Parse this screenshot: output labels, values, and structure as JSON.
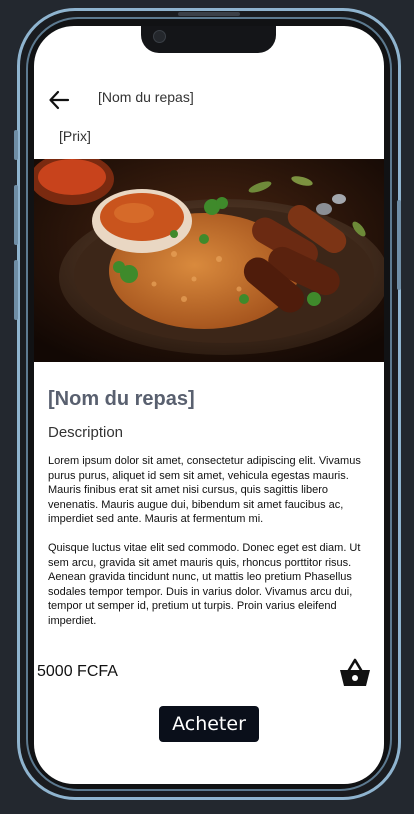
{
  "header": {
    "back_icon": "arrow-left-icon",
    "title": "[Nom du repas]"
  },
  "price_top": "[Prix]",
  "hero_image": {
    "subject": "jollof-rice-plate"
  },
  "meal": {
    "title": "[Nom du repas]",
    "description_label": "Description",
    "paragraphs": [
      "Lorem ipsum dolor sit amet, consectetur adipiscing elit. Vivamus purus purus, aliquet id sem sit amet, vehicula egestas mauris. Mauris finibus erat sit amet nisi cursus, quis sagittis libero venenatis. Mauris augue dui, bibendum sit amet faucibus ac, imperdiet sed ante. Mauris at fermentum mi.",
      "Quisque luctus vitae elit sed commodo. Donec eget est diam. Ut sem arcu, gravida sit amet mauris quis, rhoncus porttitor risus. Aenean gravida tincidunt nunc, ut mattis leo pretium Phasellus sodales tempor tempor. Duis in varius dolor. Vivamus arcu dui, tempor ut semper id, pretium ut turpis. Proin varius eleifend imperdiet."
    ]
  },
  "footer": {
    "price": "5000 FCFA",
    "cart_icon": "shopping-basket-icon",
    "buy_label": "Acheter"
  },
  "colors": {
    "background": "#23282f",
    "frame_border": "#8fb4cf",
    "title_color": "#59606f",
    "button_bg": "#0a0f1a"
  }
}
